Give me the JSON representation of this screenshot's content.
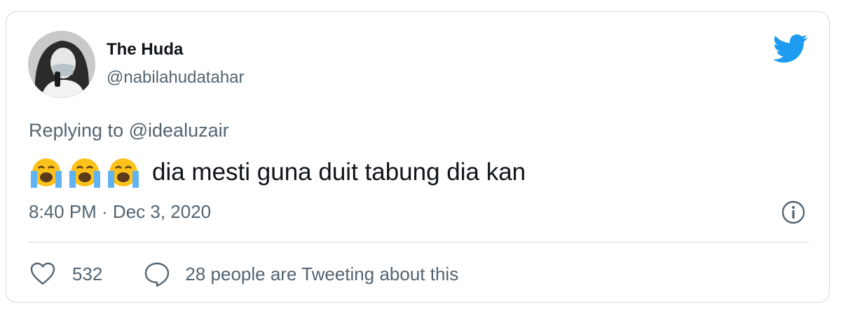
{
  "user": {
    "display_name": "The Huda",
    "handle": "@nabilahudatahar",
    "avatar_icon": "profile-photo"
  },
  "reply": {
    "prefix": "Replying to",
    "mention": "@idealuzair"
  },
  "tweet": {
    "emojis": [
      "loudly-crying-face",
      "loudly-crying-face",
      "loudly-crying-face"
    ],
    "text": "dia mesti guna duit tabung dia kan",
    "timestamp": "8:40 PM · Dec 3, 2020"
  },
  "stats": {
    "likes": "532",
    "conversation": "28 people are Tweeting about this"
  },
  "icons": {
    "brand": "twitter-bird-icon",
    "info": "info-icon",
    "like": "heart-icon",
    "reply": "speech-bubble-icon"
  },
  "colors": {
    "twitter_blue": "#1d9bf0",
    "text_primary": "#0f1419",
    "text_secondary": "#536471",
    "border": "#cfd9de"
  }
}
